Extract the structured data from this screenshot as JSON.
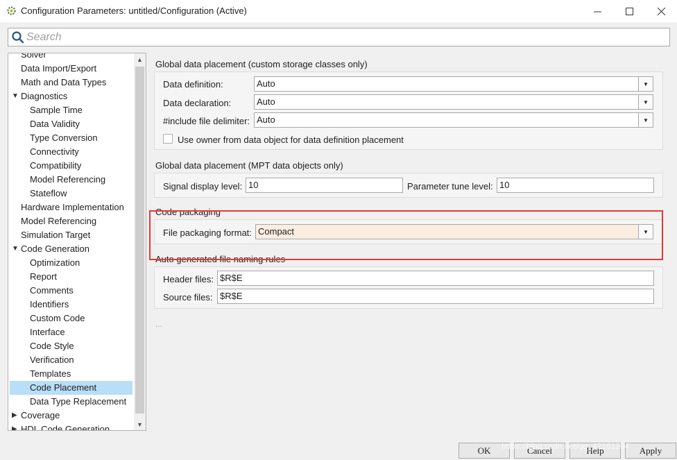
{
  "window": {
    "title": "Configuration Parameters: untitled/Configuration (Active)",
    "controls": {
      "minimize": "—",
      "maximize": "☐",
      "close": "✕"
    }
  },
  "search": {
    "placeholder": "Search"
  },
  "tree": {
    "items": [
      {
        "label": "Solver"
      },
      {
        "label": "Data Import/Export"
      },
      {
        "label": "Math and Data Types"
      },
      {
        "label": "Diagnostics"
      },
      {
        "label": "Sample Time"
      },
      {
        "label": "Data Validity"
      },
      {
        "label": "Type Conversion"
      },
      {
        "label": "Connectivity"
      },
      {
        "label": "Compatibility"
      },
      {
        "label": "Model Referencing"
      },
      {
        "label": "Stateflow"
      },
      {
        "label": "Hardware Implementation"
      },
      {
        "label": "Model Referencing"
      },
      {
        "label": "Simulation Target"
      },
      {
        "label": "Code Generation"
      },
      {
        "label": "Optimization"
      },
      {
        "label": "Report"
      },
      {
        "label": "Comments"
      },
      {
        "label": "Identifiers"
      },
      {
        "label": "Custom Code"
      },
      {
        "label": "Interface"
      },
      {
        "label": "Code Style"
      },
      {
        "label": "Verification"
      },
      {
        "label": "Templates"
      },
      {
        "label": "Code Placement"
      },
      {
        "label": "Data Type Replacement"
      },
      {
        "label": "Coverage"
      },
      {
        "label": "HDL Code Generation"
      }
    ],
    "expanded_arrow": "▼",
    "collapsed_arrow": "▶",
    "selected": "Code Placement"
  },
  "global_custom": {
    "title": "Global data placement (custom storage classes only)",
    "data_definition_label": "Data definition:",
    "data_definition_value": "Auto",
    "data_declaration_label": "Data declaration:",
    "data_declaration_value": "Auto",
    "include_delimiter_label": "#include file delimiter:",
    "include_delimiter_value": "Auto",
    "use_owner_label": "Use owner from data object for data definition placement",
    "use_owner_checked": false
  },
  "global_mpt": {
    "title": "Global data placement (MPT data objects only)",
    "signal_display_label": "Signal display level:",
    "signal_display_value": "10",
    "parameter_tune_label": "Parameter tune level:",
    "parameter_tune_value": "10"
  },
  "code_packaging": {
    "title": "Code packaging",
    "file_format_label": "File packaging format:",
    "file_format_value": "Compact"
  },
  "naming_rules": {
    "title": "Auto generated file naming rules",
    "header_label": "Header files:",
    "header_value": "$R$E",
    "source_label": "Source files:",
    "source_value": "$R$E"
  },
  "more": "...",
  "buttons": {
    "ok": "OK",
    "cancel": "Cancel",
    "help": "Help",
    "apply": "Apply"
  },
  "watermark": "https://blog.csdn.net/qq_42161204",
  "colors": {
    "highlight": "#e53935",
    "selection": "#b8def8",
    "dropdown_highlight": "#fbeee0"
  }
}
